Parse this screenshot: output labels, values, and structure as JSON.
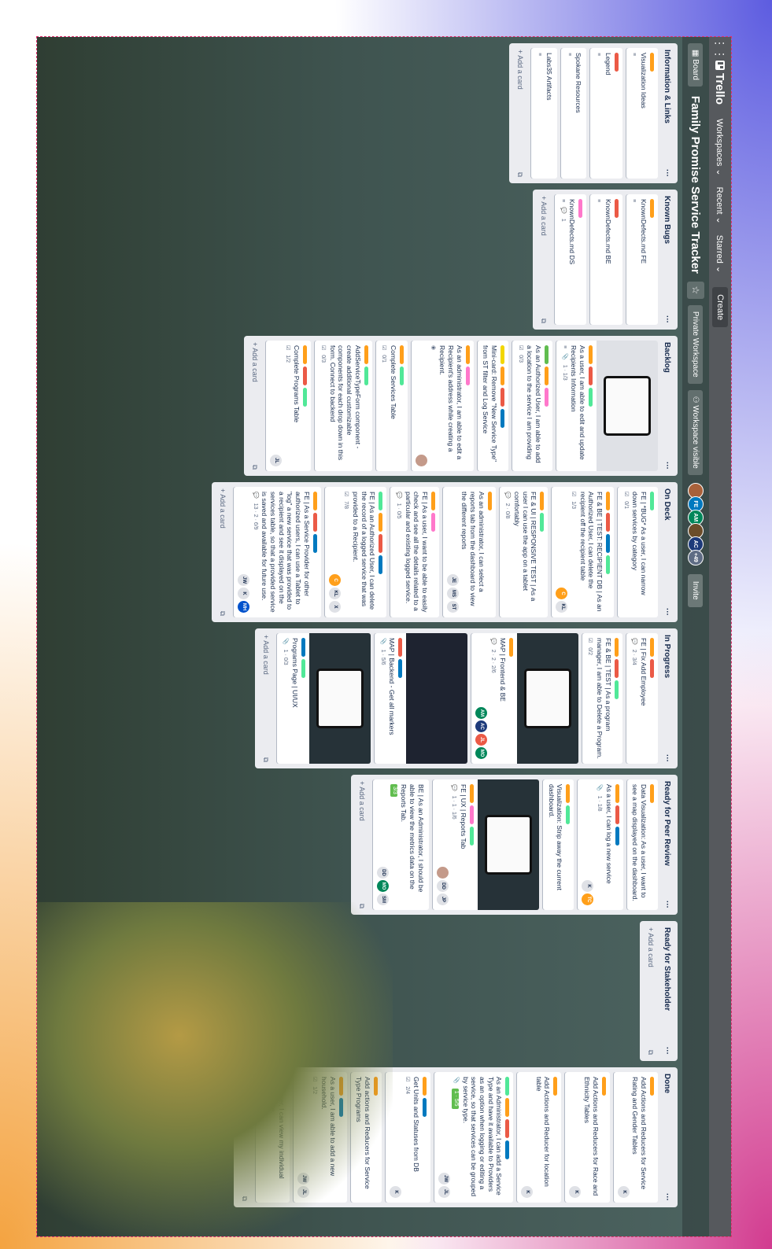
{
  "app": "Trello",
  "topbar": {
    "menus": [
      "Workspaces",
      "Recent",
      "Starred"
    ],
    "create": "Create"
  },
  "board": {
    "switcher": "Board",
    "title": "Family Promise Service Tracker",
    "workspace": "Private Workspace",
    "visibility": "Workspace visible",
    "members_more": "+49",
    "invite": "Invite"
  },
  "add_card": "+ Add a card",
  "lists": [
    {
      "title": "Information & Links",
      "cards": [
        {
          "title": "Visualization Ideas"
        },
        {
          "title": "Legend"
        },
        {
          "title": "Spokane Resources"
        },
        {
          "title": "Labs35 Artifacts"
        }
      ]
    },
    {
      "title": "Known Bugs",
      "cards": [
        {
          "title": "KnownDefects.md FE"
        },
        {
          "title": "KnownDefects.md BE"
        },
        {
          "title": "KnownDefects.md DS",
          "meta": "1"
        }
      ]
    },
    {
      "title": "Backlog",
      "cards": [
        {
          "title": "As a user, I am able to edit and update Recipients Information",
          "meta": "1 · 1/3"
        },
        {
          "title": "As an Authorized User, I am able to add a location to the service I am providing",
          "meta": "0/3"
        },
        {
          "title": "Mini-card: Remove \"New Service Type\" from ST filter and Log Service"
        },
        {
          "title": "As an administrator, I am able to edit a Recipient's address while creating a Recipient."
        },
        {
          "title": "Complete Services Table",
          "meta": "0/1"
        },
        {
          "title": "AddServiceTypeForm component - create additional customizable components for each drop down in this form. Connect to backend",
          "meta": "0/3"
        },
        {
          "title": "Complete Programs Table",
          "meta": "1/2",
          "members": [
            "JL"
          ]
        }
      ]
    },
    {
      "title": "On Deck",
      "cards": [
        {
          "title": "FE | *BUG* As a user, I can narrow down services by category",
          "meta": "0/1"
        },
        {
          "title": "FE & BE | TEST: RECIPIENT DB | As an Authorized User, I can delete the recipient off the recipient table",
          "meta": "1/3",
          "members": [
            "C",
            "KL"
          ]
        },
        {
          "title": "FE & UI | RESPONSIVE TEST | As a user I can use the app on a tablet comfortably",
          "meta": "2 · 0/8"
        },
        {
          "title": "As an administrator, I can select a reports tab from the dashboard to view the different reports",
          "members": [
            "JE",
            "MS",
            "ST"
          ]
        },
        {
          "title": "FE | As a user, I want to be able to easily check and see all the details related to a particular and existing logged service.",
          "meta": "1 · 0/5"
        },
        {
          "title": "FE | As an Authorized User, I can delete the record of a logged service that was provided to a Recipient.",
          "meta": "7/8",
          "members": [
            "C",
            "KL",
            "X"
          ]
        },
        {
          "title": "FE | As a Service Provider for other authorized users, I can use a Tablet to \"log\" a new service that was provided to a recipient and see it displayed on the services table, so that a provided service is saved and available for future use.",
          "meta": "13 · 2 · 6/9",
          "members": [
            "JW",
            "K",
            "MH"
          ]
        }
      ]
    },
    {
      "title": "In Progress",
      "cards": [
        {
          "title": "FE | Fix Add Employee",
          "meta": "2 · 3/4"
        },
        {
          "title": "FE & BE | TEST | As a program manager, I am able to Delete a Program.",
          "meta": "0/2"
        },
        {
          "title": "MAP | Frontend & BE",
          "meta": "2 · 2 · 2/6",
          "members": [
            "AM",
            "AC",
            "JL",
            "MO"
          ]
        },
        {
          "title": "MAP | Backend - Get all markers",
          "meta": "1 · 5/6"
        },
        {
          "title": "Programs Page | UI/UX",
          "meta": "1 · 0/3"
        }
      ]
    },
    {
      "title": "Ready for Peer Review",
      "cards": [
        {
          "title": "Data Visualization: As a user, I want to see a map displayed on the dashboard."
        },
        {
          "title": "As a user, I can log a new service",
          "meta": "1 · 1/8",
          "members": [
            "K",
            "TC"
          ]
        },
        {
          "title": "Visualization: Strip away the current dashboard."
        },
        {
          "title": "FE | UX | Reports Tab",
          "meta": "1 · 1 · 1/6",
          "members": [
            "DD",
            "JP"
          ]
        },
        {
          "title": "BE | As an Administrator, I should be able to view the metrics data on the Reports Tab.",
          "meta": "3/3",
          "members": [
            "DD",
            "MO",
            "SM"
          ]
        }
      ]
    },
    {
      "title": "Ready for Stakeholder",
      "cards": []
    },
    {
      "title": "Done",
      "cards": [
        {
          "title": "Add Actions and Reducers for Service Rating and Gender Tables",
          "members": [
            "K"
          ]
        },
        {
          "title": "Add Actions and Reducers for Race and Ethnicity Tables",
          "members": [
            "K"
          ]
        },
        {
          "title": "Add Actions and Reducer for location table",
          "members": [
            "K"
          ]
        },
        {
          "title": "As an Administrator, I can add a Service Type and have it available to Providers as an option when logging or editing a service, so that services can be grouped by service type.",
          "meta": "1 · 5/5",
          "members": [
            "JW",
            "JL"
          ]
        },
        {
          "title": "Get Units and Statuses from DB",
          "meta": "2/4",
          "members": [
            "K"
          ]
        },
        {
          "title": "Add actions and Reducers for Service Type Programs"
        },
        {
          "title": "As a user, I am able to add a new household.",
          "meta": "1/2",
          "members": [
            "JW",
            "JL"
          ]
        },
        {
          "title": "As a user, I can view my individual profile page.",
          "meta": "1"
        }
      ]
    }
  ],
  "colors": {
    "topbar": "#56595d",
    "list_bg": "#ebecf0",
    "green": "#61bd4f",
    "yellow": "#f2d600",
    "orange": "#ff9f1a",
    "red": "#eb5a46",
    "blue": "#0079bf",
    "pink": "#ff78cb",
    "lime": "#51e898",
    "teal": "#00c2e0"
  }
}
